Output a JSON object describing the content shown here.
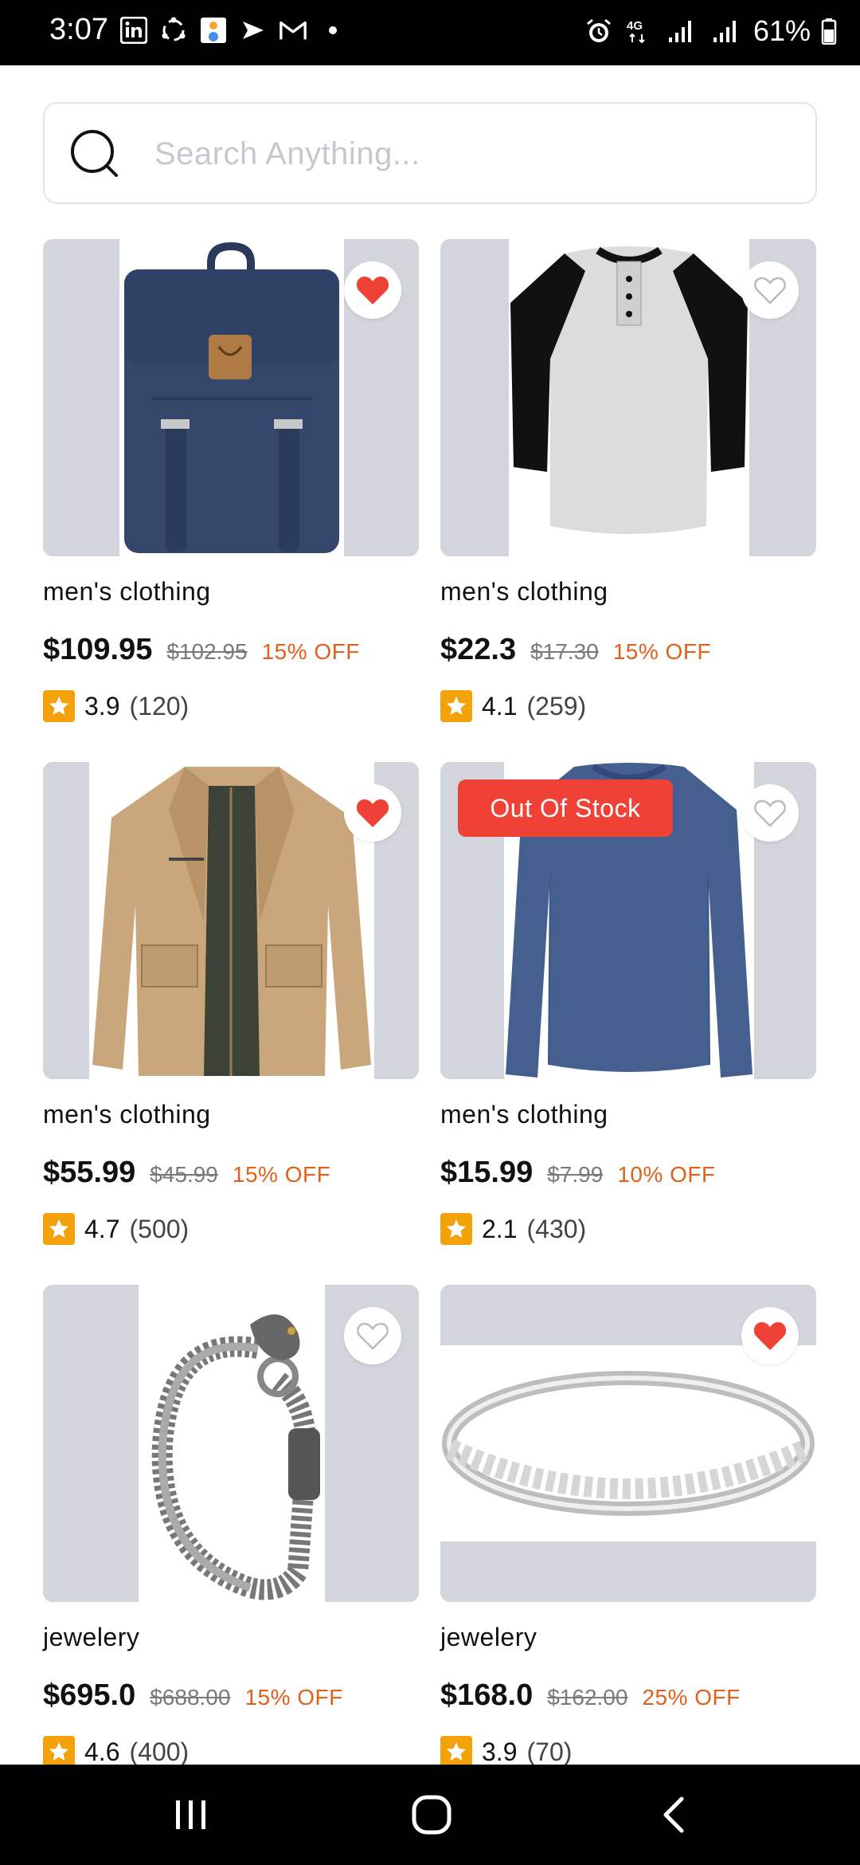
{
  "status": {
    "time": "3:07",
    "network": "4G",
    "battery": "61%"
  },
  "search": {
    "placeholder": "Search Anything..."
  },
  "products": [
    {
      "category": "men's clothing",
      "price": "$109.95",
      "old_price": "$102.95",
      "discount": "15% OFF",
      "rating": "3.9",
      "reviews": "(120)",
      "favorite": true,
      "out_of_stock": false,
      "image": "navy-backpack"
    },
    {
      "category": "men's clothing",
      "price": "$22.3",
      "old_price": "$17.30",
      "discount": "15% OFF",
      "rating": "4.1",
      "reviews": "(259)",
      "favorite": false,
      "out_of_stock": false,
      "image": "raglan-henley-shirt"
    },
    {
      "category": "men's clothing",
      "price": "$55.99",
      "old_price": "$45.99",
      "discount": "15% OFF",
      "rating": "4.7",
      "reviews": "(500)",
      "favorite": true,
      "out_of_stock": false,
      "image": "khaki-jacket"
    },
    {
      "category": "men's clothing",
      "price": "$15.99",
      "old_price": "$7.99",
      "discount": "10% OFF",
      "rating": "2.1",
      "reviews": "(430)",
      "favorite": false,
      "out_of_stock": true,
      "image": "navy-long-sleeve-tee"
    },
    {
      "category": "jewelery",
      "price": "$695.0",
      "old_price": "$688.00",
      "discount": "15% OFF",
      "rating": "4.6",
      "reviews": "(400)",
      "favorite": false,
      "out_of_stock": false,
      "image": "dragon-chain-bracelet"
    },
    {
      "category": "jewelery",
      "price": "$168.0",
      "old_price": "$162.00",
      "discount": "25% OFF",
      "rating": "3.9",
      "reviews": "(70)",
      "favorite": true,
      "out_of_stock": false,
      "image": "silver-diamond-ring"
    }
  ],
  "labels": {
    "out_of_stock": "Out Of Stock"
  },
  "colors": {
    "favorite_red": "#ef4136",
    "discount_orange": "#e35f1c",
    "star_yellow": "#f3a20b",
    "image_bg": "#d3d5dc"
  },
  "icons": [
    "search-icon",
    "heart-filled-icon",
    "heart-outline-icon",
    "star-icon",
    "recent-apps-icon",
    "home-icon",
    "back-icon"
  ]
}
